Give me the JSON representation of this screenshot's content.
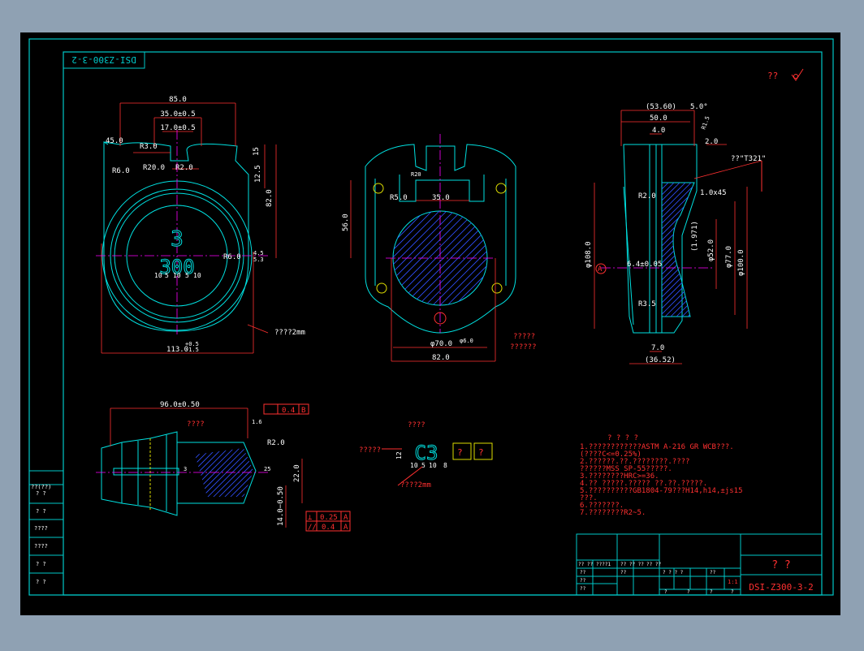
{
  "drawing": {
    "top_code": "DSI-Z300-3-2",
    "mark_qq": "??",
    "view1": {
      "dims": {
        "width_top": "85.0",
        "slot_outer": "35.0±0.5",
        "slot_inner": "17.0±0.5",
        "angle": "45.0",
        "r_small": "R3.0",
        "r_left": "R6.0",
        "r_mid": "R20.0",
        "r_right": "R2.0",
        "h1": "15",
        "h2": "12.5",
        "h3": "82.0",
        "r_side": "R6.0",
        "base": "113.0",
        "tol_up": "+0.5",
        "tol_dn": "-1.5",
        "note": "????2mm",
        "t1": "4.5",
        "t2": "5.3"
      },
      "emboss_top": "3",
      "emboss_bot": "300",
      "char_dims": [
        "10",
        "5",
        "10",
        "5",
        "10"
      ]
    },
    "view2": {
      "dims": {
        "r5": "R5.0",
        "w35": "35.0",
        "r_top": "R20",
        "h56": "56.0",
        "phi70": "φ70.0",
        "phi6": "φ6.0",
        "w82": "82.0"
      },
      "note1": "?????",
      "note2": "??????"
    },
    "view3": {
      "dims": {
        "d1": "(53.60)",
        "d2": "50.0",
        "d3": "4.0",
        "ang": "5.0°",
        "r15": "R1.5",
        "t2": "2.0",
        "mat": "??\"T321\"",
        "r2": "R2.0",
        "c": "1.0x45",
        "phi108": "φ108.0",
        "phi52": "φ52.0",
        "phi77": "φ77.0",
        "phi100": "φ100.0",
        "d197": "(1.971)",
        "r35": "R3.5",
        "tail": "7.0",
        "base": "(36.52)",
        "keyw": "6.4±0.05",
        "letter": "A"
      }
    },
    "view4": {
      "dims": {
        "len": "96.0±0.50",
        "tol": "0.4",
        "datum": "B",
        "ra": "1.6",
        "r2": "R2.0",
        "h22": "22.0",
        "h14": "14.0−0.50",
        "ang": "25",
        "n3": "3"
      },
      "label": "????",
      "fc1": {
        "sym": "⊥",
        "tol": "0.25",
        "datum": "A"
      },
      "fc2": {
        "sym": "//",
        "tol": "0.4",
        "datum": "A"
      }
    },
    "mark": {
      "title": "????",
      "label": "?????",
      "text": "C3",
      "boxes": [
        "?",
        "?"
      ],
      "dims": [
        "10",
        "5",
        "10",
        "8"
      ],
      "h": "12",
      "note": "????2mm"
    },
    "notes": [
      "? ? ? ?",
      "1.????????????ASTM A-216 GR WCB???.",
      "  (????C<=0.25%)",
      "2.??????.??.????????.????",
      "  ??????MSS SP-55?????.",
      "3.????????HRC>=36.",
      "4.?? ?????.????? ??.??.?????.",
      "5.??????????GB1804-79???H14,h14,±js15",
      "  ???.",
      "6.???????.",
      "7.????????R2~5."
    ],
    "side_table": [
      "??(??)",
      "?  ?",
      "?  ?",
      "????",
      "????",
      "?  ?",
      "?  ?"
    ],
    "title_block": {
      "name": "?   ?",
      "code": "DSI-Z300-3-2",
      "scale": "1:1",
      "small": [
        "?? ??",
        "????1",
        "?? ?? ??",
        "?? ??",
        "??",
        "??",
        "??",
        "? ? ? ?",
        "??",
        "??",
        "?",
        "?",
        "?",
        "?"
      ]
    }
  }
}
